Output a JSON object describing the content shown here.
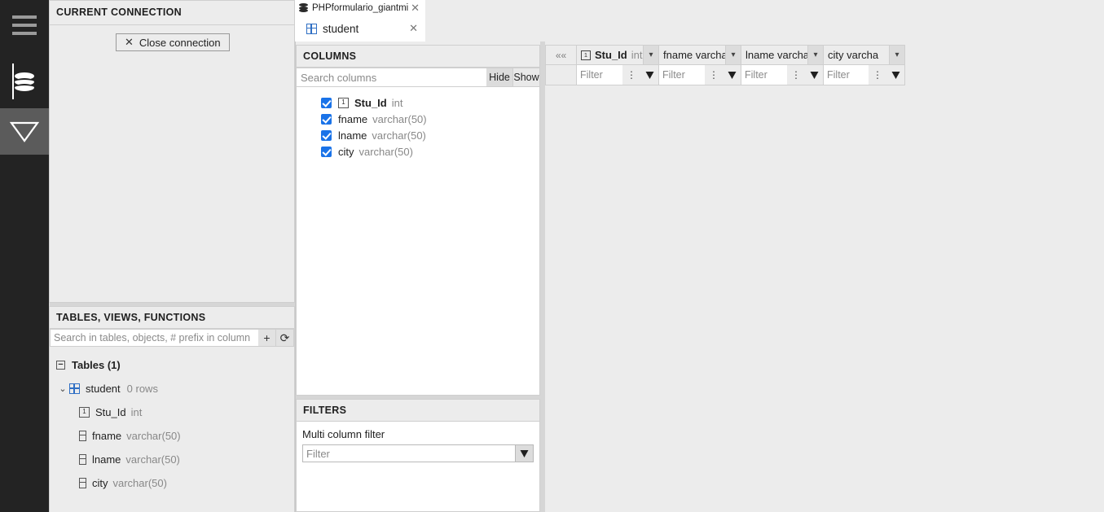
{
  "rail": {
    "items": [
      {
        "name": "menu",
        "icon": "hamburger-icon"
      },
      {
        "name": "database",
        "icon": "database-icon",
        "selected": true
      },
      {
        "name": "filter",
        "icon": "funnel-icon",
        "active": true
      }
    ]
  },
  "connection_panel": {
    "title": "CURRENT CONNECTION",
    "close_button_label": "Close connection",
    "close_button_icon": "close-x-icon"
  },
  "tables_panel": {
    "title": "TABLES, VIEWS, FUNCTIONS",
    "search_placeholder": "Search in tables, objects, # prefix in column",
    "search_value": "",
    "add_button_label": "+",
    "refresh_button_label": "⟳",
    "tree": {
      "group_label": "Tables (1)",
      "group_toggle": "−",
      "table": {
        "name": "student",
        "rows_label": "0 rows",
        "chevron": "⌄"
      },
      "columns": [
        {
          "name": "Stu_Id",
          "type": "int",
          "icon": "primary-key-icon"
        },
        {
          "name": "fname",
          "type": "varchar(50)",
          "icon": "column-icon"
        },
        {
          "name": "lname",
          "type": "varchar(50)",
          "icon": "column-icon"
        },
        {
          "name": "city",
          "type": "varchar(50)",
          "icon": "column-icon"
        }
      ]
    }
  },
  "tabs": {
    "connection_tab": {
      "label": "PHPformulario_giantmixat",
      "icon": "database-icon",
      "close": "✕"
    },
    "table_tab": {
      "label": "student",
      "icon": "table-grid-icon",
      "close": "✕"
    }
  },
  "columns_panel": {
    "title": "COLUMNS",
    "search_placeholder": "Search columns",
    "search_value": "",
    "hide_label": "Hide",
    "show_label": "Show",
    "columns": [
      {
        "name": "Stu_Id",
        "type": "int",
        "checked": true,
        "icon": "primary-key-icon",
        "bold": true
      },
      {
        "name": "fname",
        "type": "varchar(50)",
        "checked": true,
        "icon": "none",
        "bold": false
      },
      {
        "name": "lname",
        "type": "varchar(50)",
        "checked": true,
        "icon": "none",
        "bold": false
      },
      {
        "name": "city",
        "type": "varchar(50)",
        "checked": true,
        "icon": "none",
        "bold": false
      }
    ]
  },
  "filters_panel": {
    "title": "FILTERS",
    "multi_column_label": "Multi column filter",
    "filter_placeholder": "Filter",
    "filter_value": "",
    "apply_icon": "funnel-icon"
  },
  "data_grid": {
    "collapse_button": "««",
    "columns": [
      {
        "label": "Stu_Id",
        "type": "int",
        "icon": "primary-key-icon",
        "bold": true,
        "filter_placeholder": "Filter",
        "filter_value": ""
      },
      {
        "label": "fname varcha",
        "type": "",
        "icon": "none",
        "bold": false,
        "filter_placeholder": "Filter",
        "filter_value": ""
      },
      {
        "label": "lname varcha",
        "type": "",
        "icon": "none",
        "bold": false,
        "filter_placeholder": "Filter",
        "filter_value": ""
      },
      {
        "label": "city varcha",
        "type": "",
        "icon": "none",
        "bold": false,
        "filter_placeholder": "Filter",
        "filter_value": ""
      }
    ],
    "rows": [],
    "caret_icon": "chevron-down-icon",
    "menu_icon": "vertical-dots-icon",
    "filter_icon": "funnel-icon"
  },
  "colors": {
    "rail_bg": "#232323",
    "rail_active": "#5b5b5b",
    "panel_bg": "#ececec",
    "accent_blue": "#1a73e8",
    "grid_icon_blue": "#2f6fc4",
    "border": "#cfcfcf",
    "muted_text": "#888888"
  }
}
